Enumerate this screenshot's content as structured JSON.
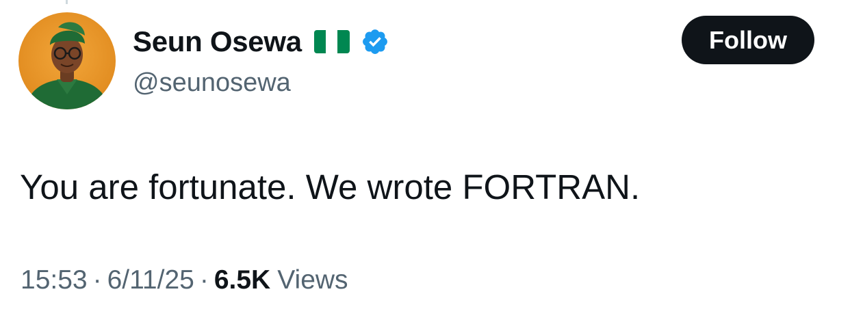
{
  "tweet": {
    "author": {
      "display_name": "Seun Osewa",
      "handle": "@seunosewa",
      "flag_icon": "nigeria-flag-icon",
      "verified_icon": "verified-badge-icon",
      "verified_color": "#1d9bf0",
      "flag_colors": [
        "#008751",
        "#ffffff",
        "#008751"
      ],
      "avatar_icon": "avatar-illustration"
    },
    "follow_label": "Follow",
    "text": "You are fortunate. We wrote FORTRAN.",
    "time": "15:53",
    "date": "6/11/25",
    "separator": "·",
    "views_count": "6.5K",
    "views_label": "Views"
  }
}
